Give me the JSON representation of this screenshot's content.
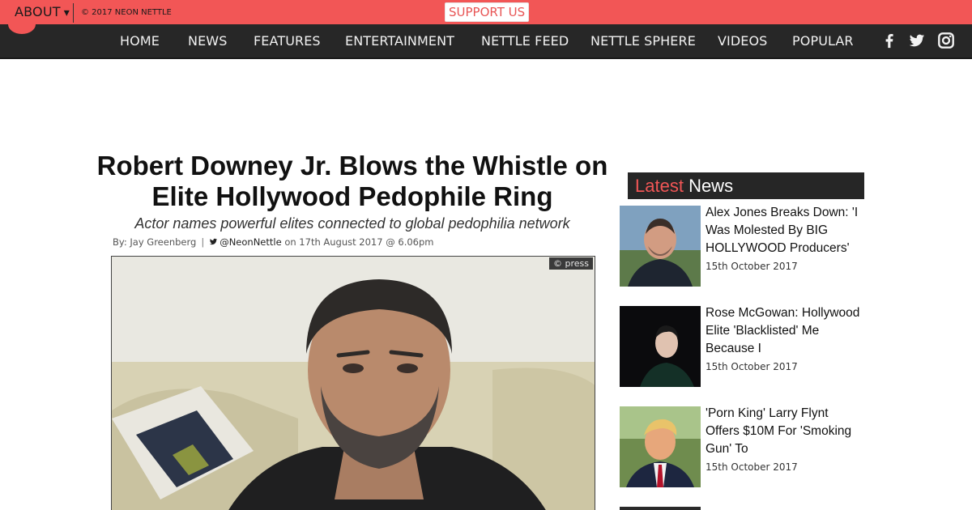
{
  "topbar": {
    "about_label": "ABOUT",
    "caret": "▾",
    "copyright": "© 2017 NEON NETTLE",
    "support_label": "SUPPORT US"
  },
  "nav": {
    "items": [
      "HOME",
      "NEWS",
      "FEATURES",
      "ENTERTAINMENT",
      "NETTLE FEED",
      "NETTLE SPHERE",
      "VIDEOS",
      "POPULAR"
    ],
    "social": [
      "facebook-icon",
      "twitter-icon",
      "instagram-icon"
    ]
  },
  "article": {
    "headline_line1": "Robert Downey Jr. Blows the Whistle on",
    "headline_line2": "Elite Hollywood Pedophile Ring",
    "subhead": "Actor names powerful elites connected to global pedophilia network",
    "byline": {
      "by": "By: Jay Greenberg",
      "handle": "@NeonNettle",
      "date": "on 17th August 2017 @ 6.06pm"
    },
    "image_credit": "© press"
  },
  "sidebar": {
    "heading_accent": "Latest",
    "heading_rest": "News",
    "stories": [
      {
        "title": "Alex Jones Breaks Down: 'I Was Molested By BIG HOLLYWOOD Producers'",
        "date": "15th October 2017"
      },
      {
        "title": "Rose McGowan: Hollywood Elite 'Blacklisted' Me Because I",
        "date": "15th October 2017"
      },
      {
        "title": "'Porn King' Larry Flynt Offers $10M For 'Smoking Gun' To",
        "date": "15th October 2017"
      }
    ]
  },
  "colors": {
    "brand_red": "#f25656",
    "nav_bg": "#272727"
  }
}
